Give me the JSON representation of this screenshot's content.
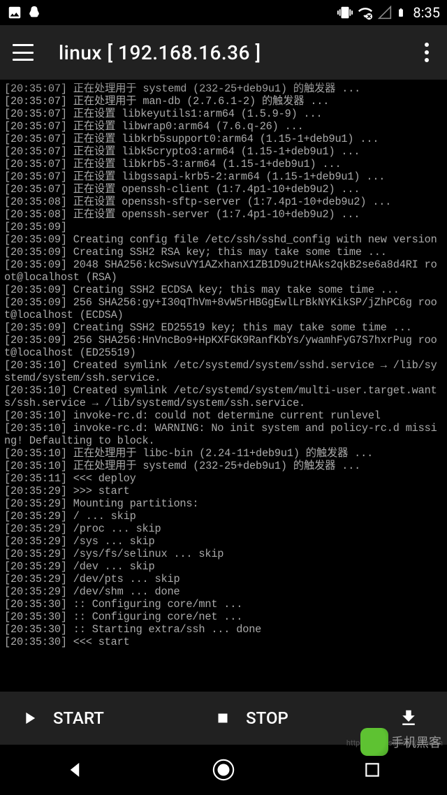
{
  "status": {
    "time": "8:35"
  },
  "appbar": {
    "title": "linux  [ 192.168.16.36 ]"
  },
  "terminal_lines": [
    "[20:35:07] 正在处理用于 systemd (232-25+deb9u1) 的触发器 ...",
    "[20:35:07] 正在处理用于 man-db (2.7.6.1-2) 的触发器 ...",
    "[20:35:07] 正在设置 libkeyutils1:arm64 (1.5.9-9) ...",
    "[20:35:07] 正在设置 libwrap0:arm64 (7.6.q-26) ...",
    "[20:35:07] 正在设置 libkrb5support0:arm64 (1.15-1+deb9u1) ...",
    "[20:35:07] 正在设置 libk5crypto3:arm64 (1.15-1+deb9u1) ...",
    "[20:35:07] 正在设置 libkrb5-3:arm64 (1.15-1+deb9u1) ...",
    "[20:35:07] 正在设置 libgssapi-krb5-2:arm64 (1.15-1+deb9u1) ...",
    "[20:35:07] 正在设置 openssh-client (1:7.4p1-10+deb9u2) ...",
    "[20:35:08] 正在设置 openssh-sftp-server (1:7.4p1-10+deb9u2) ...",
    "[20:35:08] 正在设置 openssh-server (1:7.4p1-10+deb9u2) ...",
    "[20:35:09]",
    "[20:35:09] Creating config file /etc/ssh/sshd_config with new version",
    "[20:35:09] Creating SSH2 RSA key; this may take some time ...",
    "[20:35:09] 2048 SHA256:kcSwsuVY1AZxhanX1ZB1D9u2tHAks2qkB2se6a8d4RI root@localhost (RSA)",
    "[20:35:09] Creating SSH2 ECDSA key; this may take some time ...",
    "[20:35:09] 256 SHA256:gy+I30qThVm+8vW5rHBGgEwlLrBkNYKikSP/jZhPC6g root@localhost (ECDSA)",
    "[20:35:09] Creating SSH2 ED25519 key; this may take some time ...",
    "[20:35:09] 256 SHA256:HnVncBo9+HpKXFGK9RanfKbYs/ywamhFyG7S7hxrPug root@localhost (ED25519)",
    "[20:35:10] Created symlink /etc/systemd/system/sshd.service → /lib/systemd/system/ssh.service.",
    "[20:35:10] Created symlink /etc/systemd/system/multi-user.target.wants/ssh.service → /lib/systemd/system/ssh.service.",
    "[20:35:10] invoke-rc.d: could not determine current runlevel",
    "[20:35:10] invoke-rc.d: WARNING: No init system and policy-rc.d missing! Defaulting to block.",
    "[20:35:10] 正在处理用于 libc-bin (2.24-11+deb9u1) 的触发器 ...",
    "[20:35:10] 正在处理用于 systemd (232-25+deb9u1) 的触发器 ...",
    "[20:35:11] <<< deploy",
    "[20:35:29] >>> start",
    "[20:35:29] Mounting partitions:",
    "[20:35:29] / ... skip",
    "[20:35:29] /proc ... skip",
    "[20:35:29] /sys ... skip",
    "[20:35:29] /sys/fs/selinux ... skip",
    "[20:35:29] /dev ... skip",
    "[20:35:29] /dev/pts ... skip",
    "[20:35:29] /dev/shm ... done",
    "[20:35:30] :: Configuring core/mnt ...",
    "[20:35:30] :: Configuring core/net ...",
    "[20:35:30] :: Starting extra/ssh ... done",
    "[20:35:30] <<< start"
  ],
  "bottom": {
    "start": "START",
    "stop": "STOP"
  },
  "watermark": {
    "text": "手机黑客",
    "url": "http://blog.csdn.net/sxhexin"
  }
}
